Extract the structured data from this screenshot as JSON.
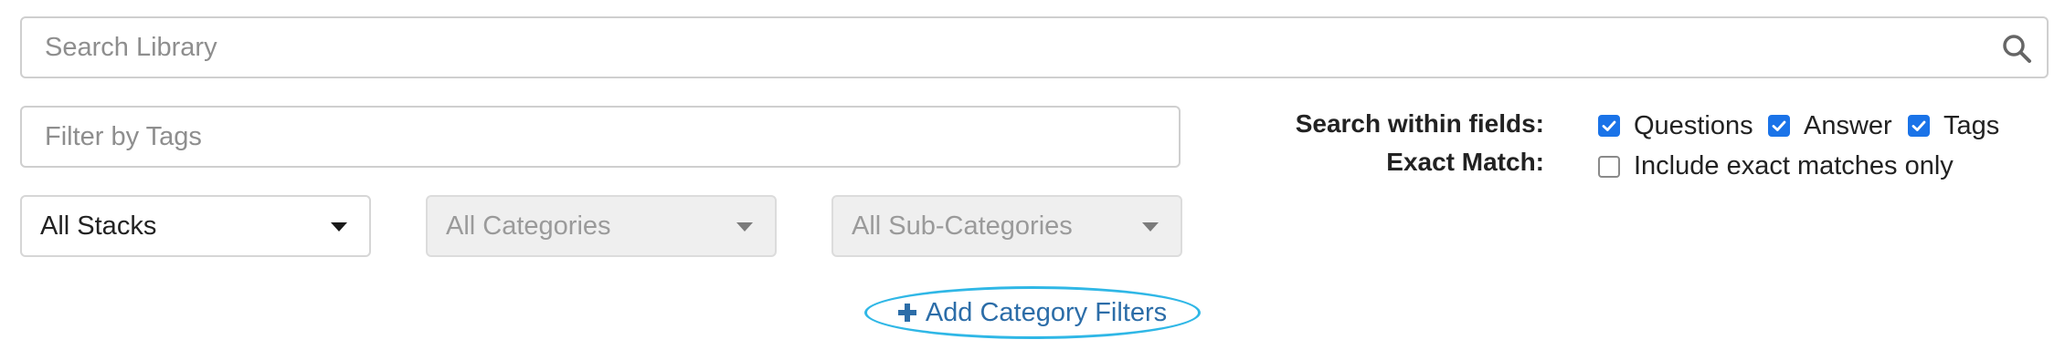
{
  "search": {
    "placeholder": "Search Library"
  },
  "tag_filter": {
    "placeholder": "Filter by Tags"
  },
  "dropdowns": {
    "stacks": {
      "selected": "All Stacks"
    },
    "categories": {
      "selected": "All Categories"
    },
    "sub_categories": {
      "selected": "All Sub-Categories"
    }
  },
  "add_filters": {
    "label": "Add Category Filters"
  },
  "search_within": {
    "label": "Search within fields:",
    "options": [
      {
        "label": "Questions",
        "checked": true
      },
      {
        "label": "Answer",
        "checked": true
      },
      {
        "label": "Tags",
        "checked": true
      }
    ]
  },
  "exact_match": {
    "label": "Exact Match:",
    "option": {
      "label": "Include exact matches only",
      "checked": false
    }
  },
  "colors": {
    "accent_blue": "#1a73e8",
    "link_blue": "#2c6da8",
    "highlight_cyan": "#2fb7e6"
  }
}
